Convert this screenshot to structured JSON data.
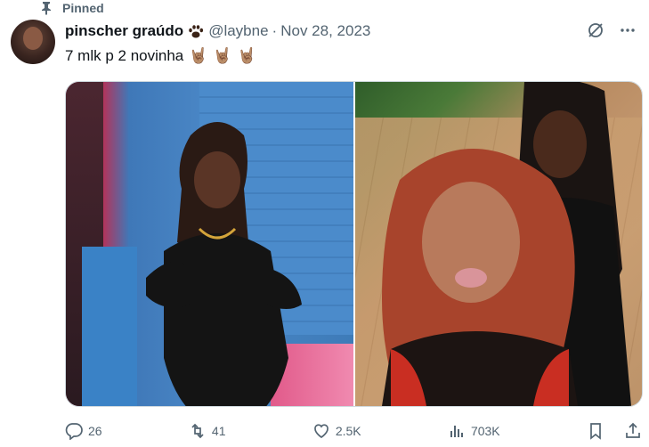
{
  "pinned": {
    "label": "Pinned",
    "icon": "pin-icon"
  },
  "author": {
    "display_name": "pinscher graúdo",
    "badge_icon": "paw-print-icon",
    "handle": "@laybne",
    "separator": "·",
    "date": "Nov 28, 2023"
  },
  "tweet": {
    "text": "7 mlk p 2 novinha",
    "emojis": [
      "🤘🏽",
      "🤘🏽",
      "🤘🏽"
    ]
  },
  "media": {
    "count": 2,
    "items": [
      "photo-left",
      "photo-right"
    ]
  },
  "actions": {
    "replies": "26",
    "reposts": "41",
    "likes": "2.5K",
    "views": "703K"
  },
  "colors": {
    "text_primary": "#0f1419",
    "text_secondary": "#536471",
    "border": "#cfd9de"
  }
}
